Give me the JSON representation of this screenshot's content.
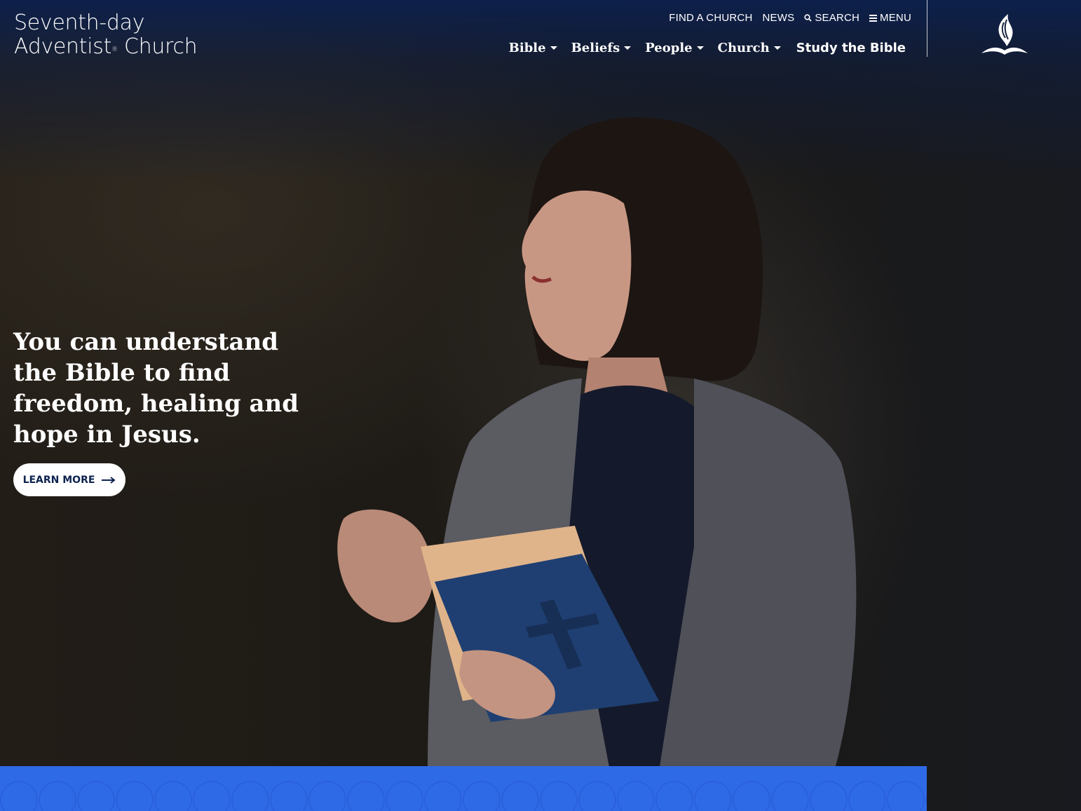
{
  "brand": {
    "line1": "Seventh-day",
    "line2": "Adventist",
    "registered": "®",
    "line3": "Church",
    "emblem_icon": "sda-flame-bible-icon"
  },
  "utility_nav": {
    "find_church": "FIND A CHURCH",
    "news": "NEWS",
    "search": "SEARCH",
    "menu": "MENU"
  },
  "main_nav": {
    "items": [
      {
        "label": "Bible",
        "has_dropdown": true
      },
      {
        "label": "Beliefs",
        "has_dropdown": true
      },
      {
        "label": "People",
        "has_dropdown": true
      },
      {
        "label": "Church",
        "has_dropdown": true
      }
    ],
    "study": "Study the Bible"
  },
  "hero": {
    "headline": "You can understand the Bible to find freedom, healing and hope in Jesus.",
    "cta_label": "LEARN MORE",
    "cta_icon": "arrow-right-icon"
  },
  "colors": {
    "header_blue": "#0c204e",
    "band_blue": "#2f6ae6",
    "cta_text": "#0e2350"
  }
}
